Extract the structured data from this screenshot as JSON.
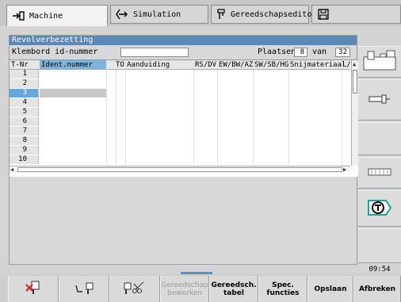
{
  "tabs": [
    {
      "label": "Machine",
      "icon": "arrow-right-box-icon",
      "active": true
    },
    {
      "label": "Simulation",
      "icon": "diamond-arrow-icon",
      "active": false
    },
    {
      "label": "Gereedschapseditor",
      "icon": "tool-holder-icon",
      "active": false
    },
    {
      "label": "",
      "icon": "floppy-icon",
      "active": false
    }
  ],
  "window": {
    "title": "Revolverbezetting",
    "clipboard_label": "Klembord id-nummer",
    "clipboard_value": "",
    "places_label": "Plaatsen",
    "places_value": "8",
    "of_label": "van",
    "of_value": "32"
  },
  "table": {
    "headers": [
      "T-Nr",
      "Ident.nummer",
      "TO",
      "Aanduiding",
      "RS/DV",
      "EW/BW/AZ",
      "SW/SB/HG",
      "Snijmateriaal",
      "L/"
    ],
    "rows": [
      {
        "nr": "1",
        "ident": ""
      },
      {
        "nr": "2",
        "ident": ""
      },
      {
        "nr": "3",
        "ident": ""
      },
      {
        "nr": "4",
        "ident": ""
      },
      {
        "nr": "5",
        "ident": ""
      },
      {
        "nr": "6",
        "ident": ""
      },
      {
        "nr": "7",
        "ident": ""
      },
      {
        "nr": "8",
        "ident": ""
      },
      {
        "nr": "9",
        "ident": ""
      },
      {
        "nr": "10",
        "ident": ""
      }
    ],
    "selected_row": 3
  },
  "side_buttons": [
    {
      "icon": "turret-tool-icon"
    },
    {
      "icon": "tool-shank-icon"
    },
    {
      "icon": "blank-icon"
    },
    {
      "icon": "tool-strip-icon"
    },
    {
      "icon": "t-tool-icon"
    },
    {
      "icon": "blank-icon"
    }
  ],
  "clock": "09:54",
  "softkeys": [
    {
      "label": "",
      "icon": "delete-tool-icon",
      "disabled": false
    },
    {
      "label": "",
      "icon": "swap-tool-icon",
      "disabled": false
    },
    {
      "label": "",
      "icon": "cut-tool-icon",
      "disabled": false
    },
    {
      "label1": "Gereedschap",
      "label2": "bewerken",
      "disabled": true
    },
    {
      "label1": "Gereedsch.",
      "label2": "tabel",
      "disabled": false
    },
    {
      "label1": "Spec.",
      "label2": "functies",
      "disabled": false
    },
    {
      "label1": "Opslaan",
      "label2": "",
      "disabled": false
    },
    {
      "label1": "Afbreken",
      "label2": "",
      "disabled": false
    }
  ],
  "colors": {
    "accent": "#5b88b8",
    "selection": "#69a7d6",
    "header_highlight": "#7fb3d8"
  }
}
